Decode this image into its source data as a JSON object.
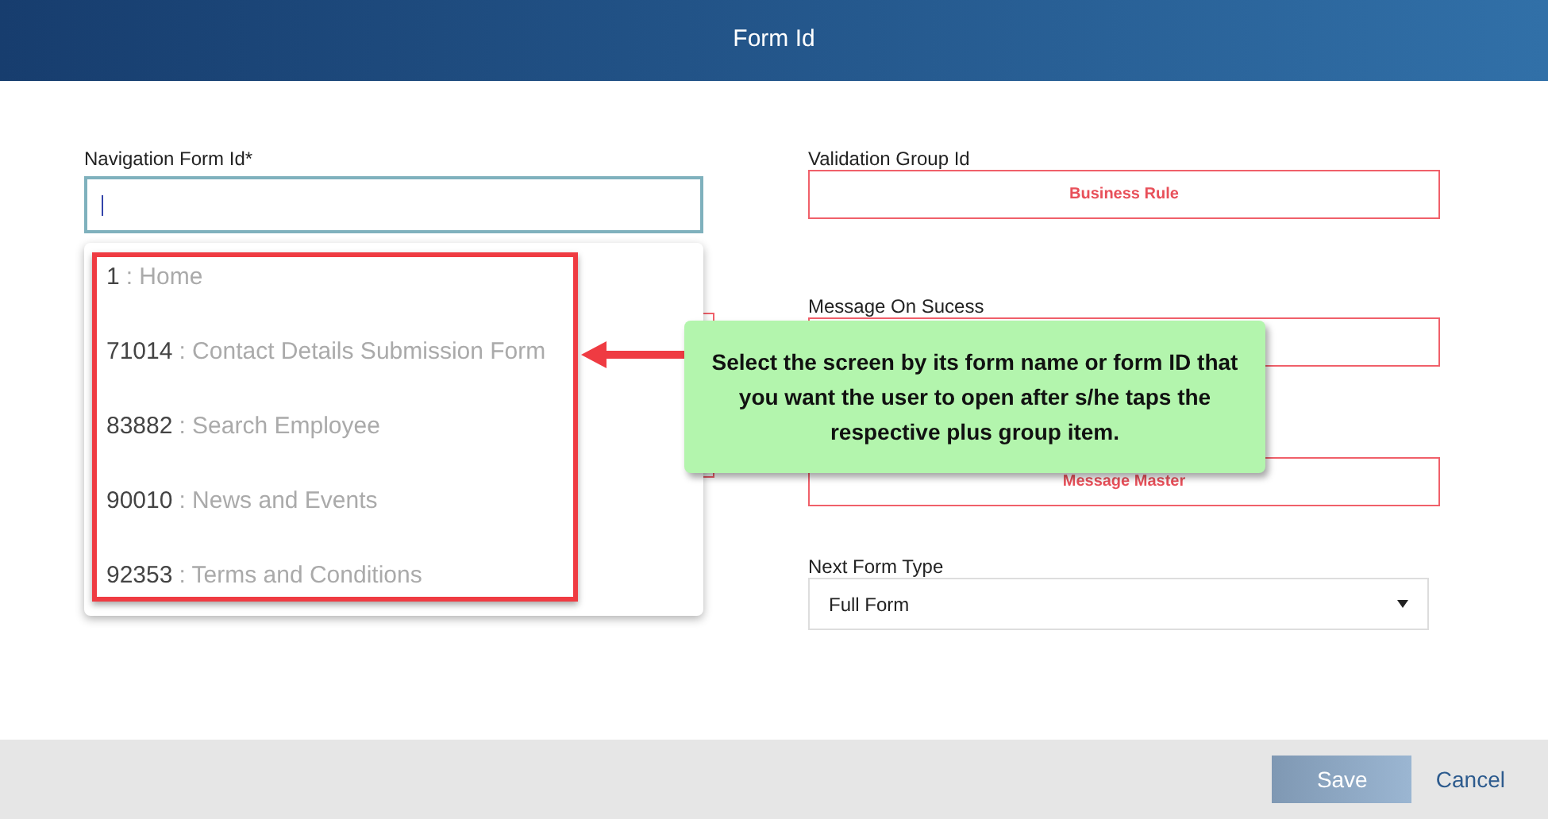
{
  "window": {
    "title": "Form Id"
  },
  "navigation_field": {
    "label": "Navigation Form Id*",
    "focused": true
  },
  "dropdown": {
    "options": [
      {
        "id": "1",
        "name": ": Home"
      },
      {
        "id": "71014",
        "name": ": Contact Details Submission Form"
      },
      {
        "id": "83882",
        "name": ": Search Employee"
      },
      {
        "id": "90010",
        "name": ": News and Events"
      },
      {
        "id": "92353",
        "name": ": Terms and Conditions"
      }
    ]
  },
  "right_fields": [
    {
      "kind": "picker",
      "label": "Validation Group Id",
      "value": "Business Rule"
    },
    {
      "kind": "picker",
      "label": "Message On Sucess"
    },
    {
      "kind": "picker",
      "value": "Message Master"
    },
    {
      "kind": "select",
      "label": "Next Form Type",
      "value": "Full Form"
    }
  ],
  "callout": {
    "text": "Select the screen by its form name or form ID that you want the user to open after s/he taps the respective plus group item."
  },
  "footer": {
    "buttons": [
      {
        "kind": "primary",
        "label": "Save",
        "disabled": true
      },
      {
        "kind": "link",
        "label": "Cancel",
        "disabled": false
      }
    ]
  }
}
